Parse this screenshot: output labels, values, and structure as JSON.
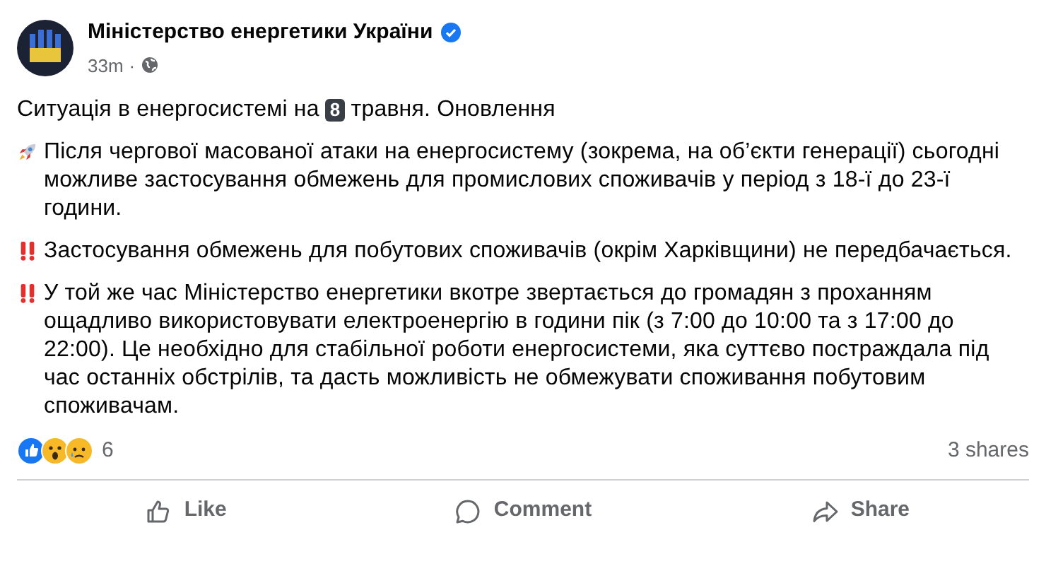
{
  "post": {
    "author": "Міністерство енергетики України",
    "verified": true,
    "time": "33m",
    "separator": "·",
    "public": true,
    "headline": {
      "before": "Ситуація в енергосистемі на",
      "keycap": "8",
      "after": "травня. Оновлення"
    },
    "paragraphs": [
      {
        "kind": "rocket",
        "text": "Після чергової масованої атаки на енергосистему (зокрема, на об’єкти генерації) сьогодні можливе застосування обмежень для промислових споживачів у період з 18-ї до 23-ї години."
      },
      {
        "kind": "alert",
        "text": "Застосування обмежень для побутових споживачів (окрім Харківщини) не передбачається."
      },
      {
        "kind": "alert",
        "text": "У той же час Міністерство енергетики вкотре звертається до громадян з проханням ощадливо використовувати електроенергію в години пік (з 7:00 до 10:00 та з 17:00 до 22:00). Це необхідно для стабільної роботи енергосистеми, яка суттєво постраждала під час останніх обстрілів, та дасть можливість не обмежувати споживання побутовим споживачам."
      }
    ],
    "reactions": {
      "count": "6",
      "faces": [
        {
          "kind": "like"
        },
        {
          "kind": "wow"
        },
        {
          "kind": "sad"
        }
      ]
    },
    "shares": "3 shares",
    "actions": [
      {
        "kind": "like",
        "label": "Like"
      },
      {
        "kind": "comment",
        "label": "Comment"
      },
      {
        "kind": "share",
        "label": "Share"
      }
    ]
  }
}
